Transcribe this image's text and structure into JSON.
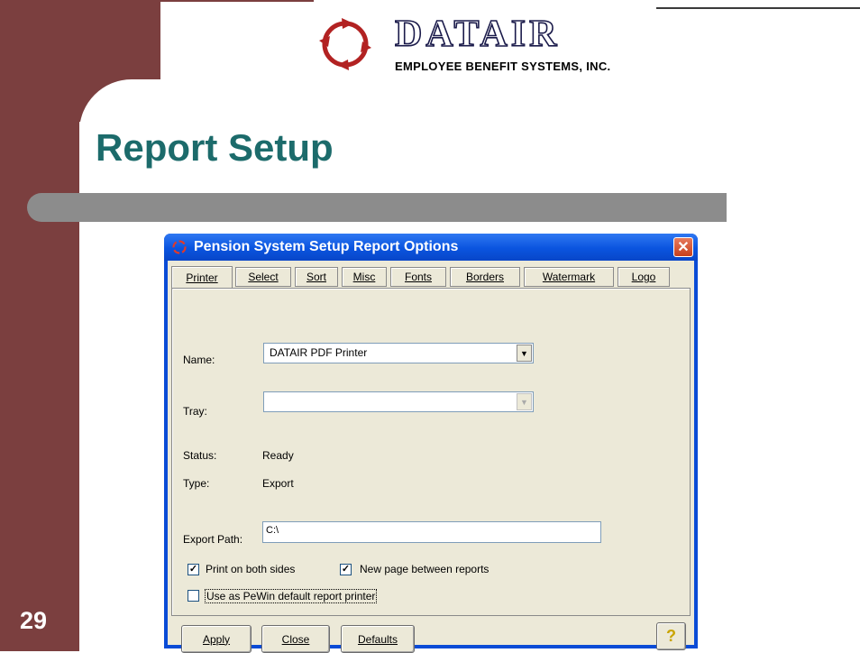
{
  "slide": {
    "title": "Report Setup",
    "number": "29",
    "logo_word": "DATAIR",
    "logo_sub": "EMPLOYEE BENEFIT SYSTEMS, INC."
  },
  "dialog": {
    "title": "Pension System Setup Report Options",
    "tabs": [
      {
        "label": "Printer",
        "active": true
      },
      {
        "label": "Select"
      },
      {
        "label": "Sort"
      },
      {
        "label": "Misc"
      },
      {
        "label": "Fonts"
      },
      {
        "label": "Borders"
      },
      {
        "label": "Watermark"
      },
      {
        "label": "Logo"
      }
    ],
    "fields": {
      "name_label": "Name:",
      "name_value": "DATAIR PDF Printer",
      "tray_label": "Tray:",
      "tray_value": "",
      "status_label": "Status:",
      "status_value": "Ready",
      "type_label": "Type:",
      "type_value": "Export",
      "export_label": "Export Path:",
      "export_value": "C:\\"
    },
    "checkboxes": [
      {
        "label": "Print on both sides",
        "checked": true
      },
      {
        "label": "New page between reports",
        "checked": true
      },
      {
        "label": "Use as PeWin default report printer",
        "checked": false
      }
    ],
    "buttons": {
      "apply": "Apply",
      "close": "Close",
      "defaults": "Defaults"
    }
  },
  "colors": {
    "slide_maroon": "#7b3f3f",
    "title_teal": "#1c6b6b",
    "xp_blue": "#0a54df",
    "dialog_face": "#ece9d8"
  }
}
